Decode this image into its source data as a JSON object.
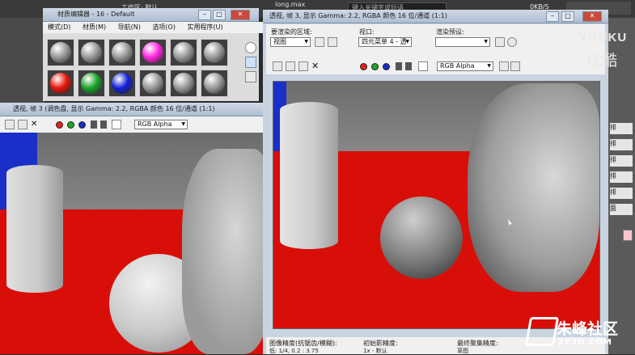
{
  "titlebar": {
    "workspace_label": "工作区: 默认",
    "file_name": "long.max",
    "search_placeholder": "键入关键字或短语",
    "net_speed": "0KB/S"
  },
  "material_editor": {
    "title": "材质编辑器 - 16 - Default",
    "menu": [
      "模式(D)",
      "材质(M)",
      "导航(N)",
      "选项(O)",
      "实用程序(U)"
    ],
    "slot_colors": [
      "#9a9a9a",
      "#9a9a9a",
      "#9a9a9a",
      "#ff27e0",
      "#9a9a9a",
      "#9a9a9a",
      "#e8160c",
      "#1ca52a",
      "#1420d8",
      "#9a9a9a",
      "#9a9a9a",
      "#9a9a9a"
    ]
  },
  "frame_left": {
    "title": "透视, 帧 3 (调色盘, 显示 Gamma: 2.2, RGBA 颜色 16 位/通道 (1:1)",
    "channel": "RGB Alpha"
  },
  "frame_right": {
    "title": "透视, 帧 3, 显示 Gamma: 2.2, RGBA 颜色 16 位/通道 (1:1)",
    "area_label": "要渲染的区域:",
    "area_value": "视图",
    "viewport_label": "视口:",
    "viewport_value": "四元菜单 4 - 透",
    "preset_label": "渲染预设:",
    "preset_value": "",
    "channel": "RGB Alpha"
  },
  "bottom_panel": {
    "label1": "图像精度(抗锯齿/模糊):",
    "label1_value": "低: 1/4, 0.2 : 3.75",
    "label2": "初始影精度:",
    "label2_value": "1x - 默认",
    "label3": "最终聚集精度:",
    "label3_value": "草图"
  },
  "right_panel": {
    "items": [
      "排",
      "排",
      "排",
      "排",
      "排",
      "面"
    ]
  },
  "watermarks": {
    "youku_latin": "YOUKU",
    "youku_cn": "优酷",
    "zf_cn": "朱峰社区",
    "zf_url": "ZF3D.COM"
  },
  "colors": {
    "floor": "#d80f08",
    "wall": "#7a7a7a",
    "blue_panel": "#1a2ec8"
  }
}
